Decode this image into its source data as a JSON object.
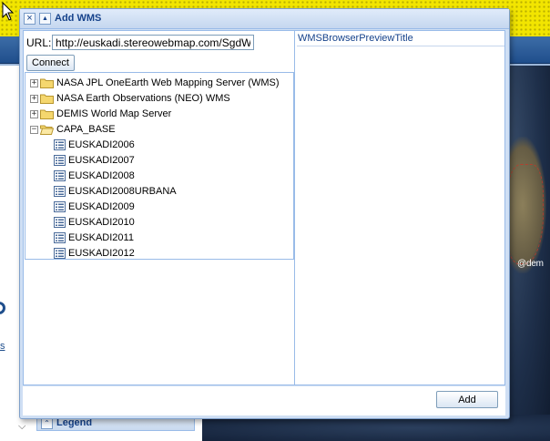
{
  "background": {
    "copyright": "@dem",
    "link_fragment": "s",
    "legend_label": "Legend"
  },
  "dialog": {
    "title": "Add WMS",
    "url_label": "URL:",
    "url_value": "http://euskadi.stereowebmap.com/SgdWmsE(",
    "connect_label": "Connect",
    "preview_title": "WMSBrowserPreviewTitle",
    "add_label": "Add",
    "tree": [
      {
        "label": "NASA JPL OneEarth Web Mapping Server (WMS)",
        "expanded": false
      },
      {
        "label": "NASA Earth Observations (NEO) WMS",
        "expanded": false
      },
      {
        "label": "DEMIS World Map Server",
        "expanded": false
      },
      {
        "label": "CAPA_BASE",
        "expanded": true,
        "children": [
          "EUSKADI2006",
          "EUSKADI2007",
          "EUSKADI2008",
          "EUSKADI2008URBANA",
          "EUSKADI2009",
          "EUSKADI2010",
          "EUSKADI2011",
          "EUSKADI2012"
        ]
      }
    ]
  },
  "colors": {
    "banner": "#f2e500",
    "nav": "#1f4e8c",
    "window_border": "#7e9fca",
    "title_text": "#15428b",
    "folder": "#f5d76e"
  }
}
